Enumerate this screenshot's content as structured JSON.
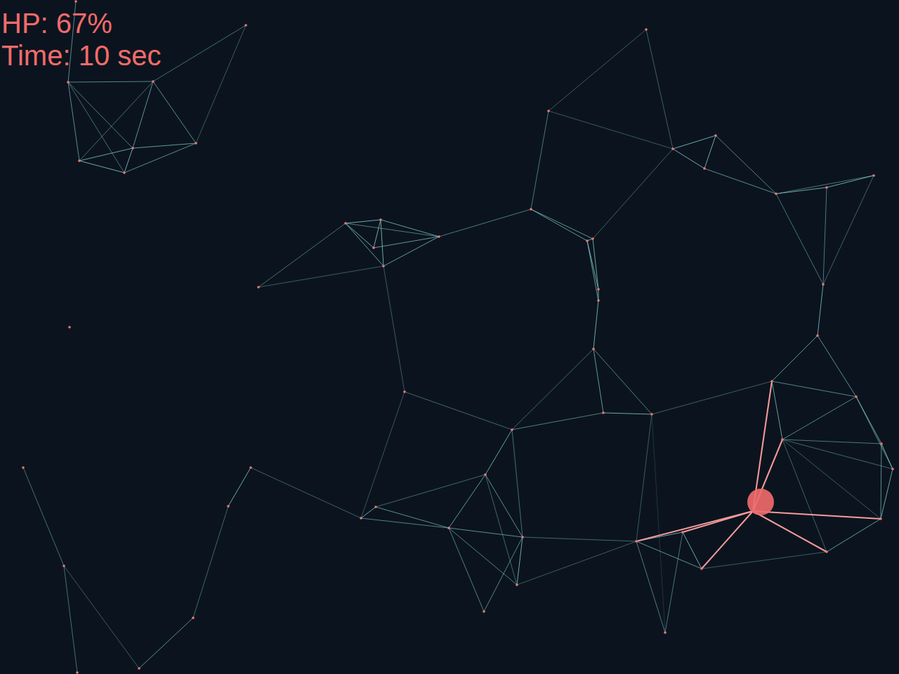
{
  "hud": {
    "hp": "HP: 67%",
    "time": "Time: 10 sec"
  }
}
